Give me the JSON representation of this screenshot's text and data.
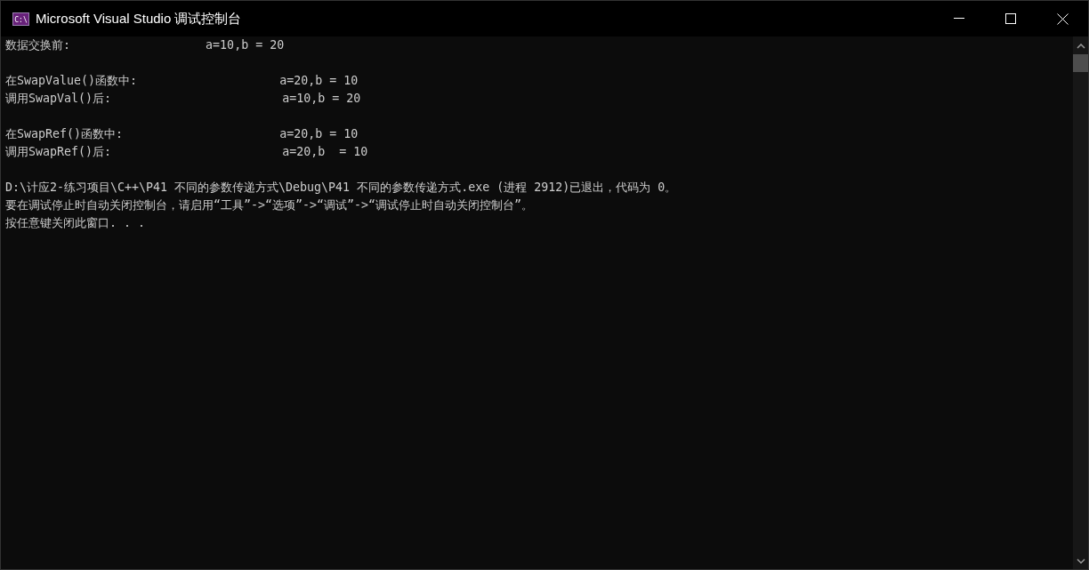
{
  "window": {
    "title": "Microsoft Visual Studio 调试控制台",
    "icon_text": "C:\\"
  },
  "console_blocks": [
    [
      "数据交换前:                   a=10,b = 20"
    ],
    [
      "在SwapValue()函数中:                    a=20,b = 10",
      "调用SwapVal()后:                        a=10,b = 20"
    ],
    [
      "在SwapRef()函数中:                      a=20,b = 10",
      "调用SwapRef()后:                        a=20,b  = 10"
    ],
    [
      "D:\\计应2-练习项目\\C++\\P41 不同的参数传递方式\\Debug\\P41 不同的参数传递方式.exe (进程 2912)已退出，代码为 0。",
      "要在调试停止时自动关闭控制台，请启用“工具”->“选项”->“调试”->“调试停止时自动关闭控制台”。",
      "按任意键关闭此窗口. . ."
    ]
  ]
}
